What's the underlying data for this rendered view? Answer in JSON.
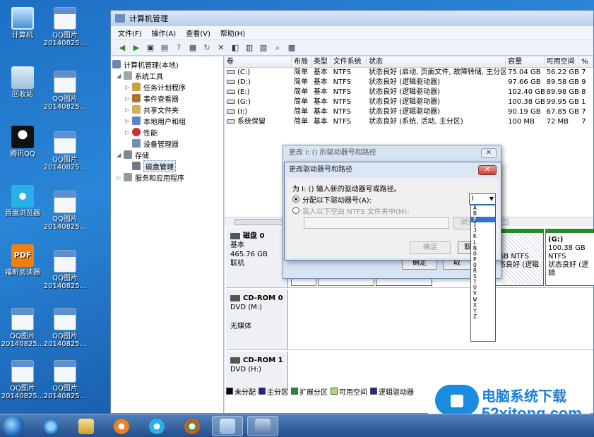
{
  "desktop": {
    "icons": [
      {
        "label": "计算机",
        "sub": ""
      },
      {
        "label": "回收站",
        "sub": ""
      },
      {
        "label": "腾讯QQ",
        "sub": ""
      },
      {
        "label": "百度浏览器",
        "sub": ""
      },
      {
        "label": "福昕阅读器",
        "sub": ""
      },
      {
        "label": "QQ图片",
        "sub": "20140825..."
      },
      {
        "label": "QQ图片",
        "sub": "20140825..."
      }
    ],
    "right_icons": [
      {
        "label": "QQ图片",
        "sub": "20140825..."
      },
      {
        "label": "QQ图片",
        "sub": "20140825..."
      },
      {
        "label": "QQ图片",
        "sub": "20140825..."
      },
      {
        "label": "QQ图片",
        "sub": "20140825..."
      },
      {
        "label": "QQ图片",
        "sub": "20140825..."
      },
      {
        "label": "QQ图片",
        "sub": "20140825..."
      },
      {
        "label": "QQ图片",
        "sub": "20140825..."
      }
    ]
  },
  "window": {
    "title": "计算机管理",
    "menu": [
      "文件(F)",
      "操作(A)",
      "查看(V)",
      "帮助(H)"
    ]
  },
  "tree": {
    "items": [
      {
        "label": "计算机管理(本地)"
      },
      {
        "label": "系统工具"
      },
      {
        "label": "任务计划程序"
      },
      {
        "label": "事件查看器"
      },
      {
        "label": "共享文件夹"
      },
      {
        "label": "本地用户和组"
      },
      {
        "label": "性能"
      },
      {
        "label": "设备管理器"
      },
      {
        "label": "存储"
      },
      {
        "label": "磁盘管理"
      },
      {
        "label": "服务和应用程序"
      }
    ]
  },
  "volumes": {
    "headers": [
      "卷",
      "布局",
      "类型",
      "文件系统",
      "状态",
      "容量",
      "可用空间",
      "%"
    ],
    "rows": [
      [
        "(C:)",
        "简单",
        "基本",
        "NTFS",
        "状态良好 (启动, 页面文件, 故障转储, 主分区)",
        "75.04 GB",
        "56.22 GB",
        "7"
      ],
      [
        "(D:)",
        "简单",
        "基本",
        "NTFS",
        "状态良好 (逻辑驱动器)",
        "97.66 GB",
        "89.58 GB",
        "9"
      ],
      [
        "(E:)",
        "简单",
        "基本",
        "NTFS",
        "状态良好 (逻辑驱动器)",
        "102.40 GB",
        "89.98 GB",
        "8"
      ],
      [
        "(G:)",
        "简单",
        "基本",
        "NTFS",
        "状态良好 (逻辑驱动器)",
        "100.38 GB",
        "99.95 GB",
        "1"
      ],
      [
        "(I:)",
        "简单",
        "基本",
        "NTFS",
        "状态良好 (逻辑驱动器)",
        "90.19 GB",
        "67.85 GB",
        "7"
      ],
      [
        "系统保留",
        "简单",
        "基本",
        "NTFS",
        "状态良好 (系统, 活动, 主分区)",
        "100 MB",
        "72 MB",
        "7"
      ]
    ]
  },
  "disks": {
    "disk0": {
      "name": "磁盘 0",
      "type": "基本",
      "size": "465.76 GB",
      "state": "联机"
    },
    "cd0": {
      "name": "CD-ROM 0",
      "drive": "DVD (M:)",
      "state": "无媒体"
    },
    "cd1": {
      "name": "CD-ROM 1",
      "drive": "DVD (H:)"
    },
    "partitions": {
      "g_label": "(G:)",
      "g_size": "100.38 GB NTFS",
      "g_state": "状态良好 (逻辑",
      "prev_size": "9 GB NTFS",
      "prev_state": "状态良好 (逻辑"
    }
  },
  "legend": [
    "未分配",
    "主分区",
    "扩展分区",
    "可用空间",
    "逻辑驱动器"
  ],
  "legend_colors": [
    "#000000",
    "#1d2a8a",
    "#2a8a2a",
    "#a8e060",
    "#1d2a8a"
  ],
  "dialog_outer": {
    "title": "更改 I: () 的驱动器号和路径",
    "ok": "确定",
    "cancel": "取"
  },
  "dialog_inner": {
    "title": "更改驱动器号和路径",
    "prompt": "为 I: () 输入新的驱动器号或路径。",
    "opt1": "分配以下驱动器号(A):",
    "opt2": "装入以下空白 NTFS 文件夹中(M):",
    "browse": "浏览",
    "ok": "确定",
    "cancel": "取"
  },
  "combo": {
    "value": "I",
    "options": [
      "A",
      "B",
      "F",
      "I",
      "J",
      "K",
      "L",
      "N",
      "O",
      "P",
      "Q",
      "R",
      "S",
      "T",
      "U",
      "V",
      "W",
      "X",
      "Y",
      "Z"
    ],
    "highlighted": "F"
  },
  "watermark": {
    "cn": "电脑系统下载",
    "en": "52xitong.com"
  }
}
